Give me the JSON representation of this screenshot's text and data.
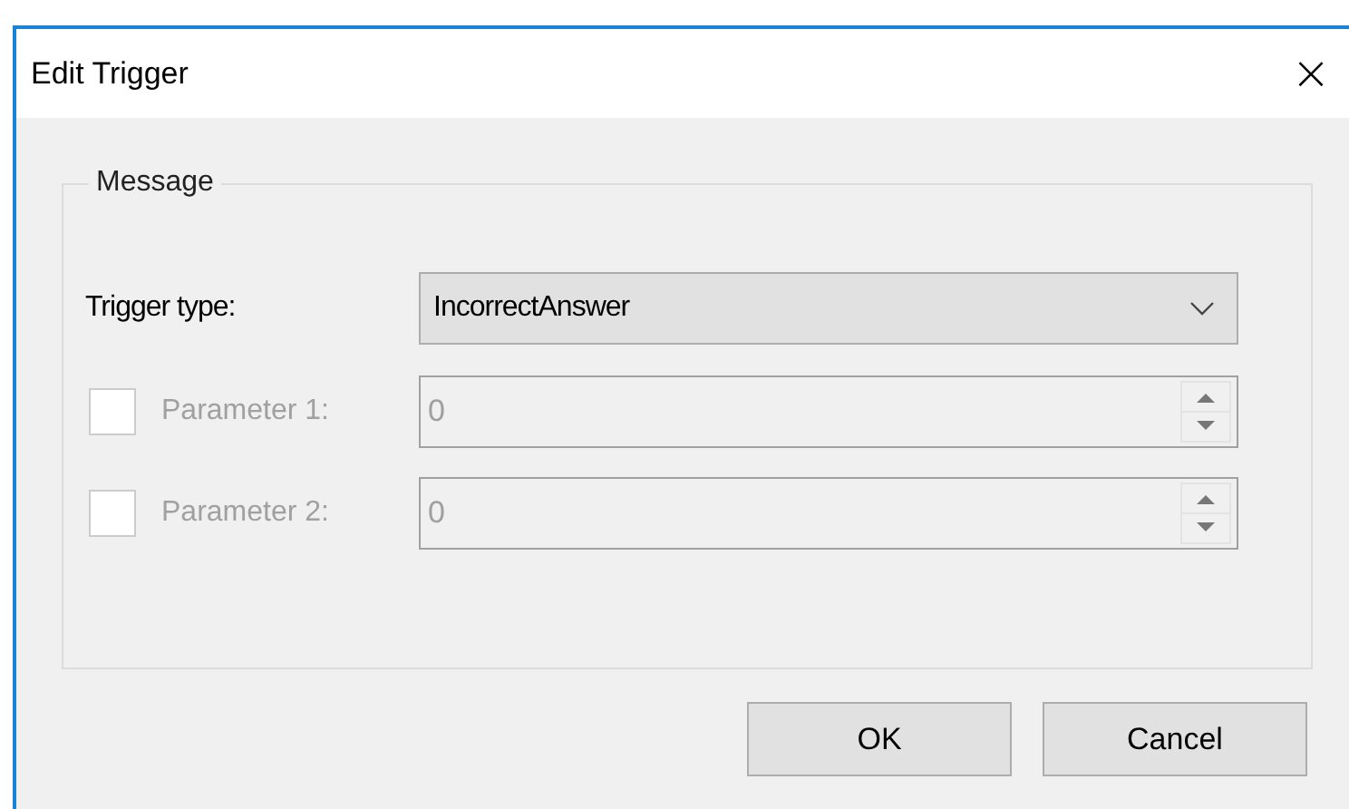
{
  "window": {
    "title": "Edit Trigger",
    "close": "×"
  },
  "group": {
    "title": "Message"
  },
  "trigger_type": {
    "label": "Trigger type:",
    "value": "IncorrectAnswer"
  },
  "parameters": [
    {
      "label": "Parameter 1:",
      "value": "0",
      "checked": false,
      "disabled": true
    },
    {
      "label": "Parameter 2:",
      "value": "0",
      "checked": false,
      "disabled": true
    }
  ],
  "buttons": [
    "OK",
    "Cancel"
  ]
}
